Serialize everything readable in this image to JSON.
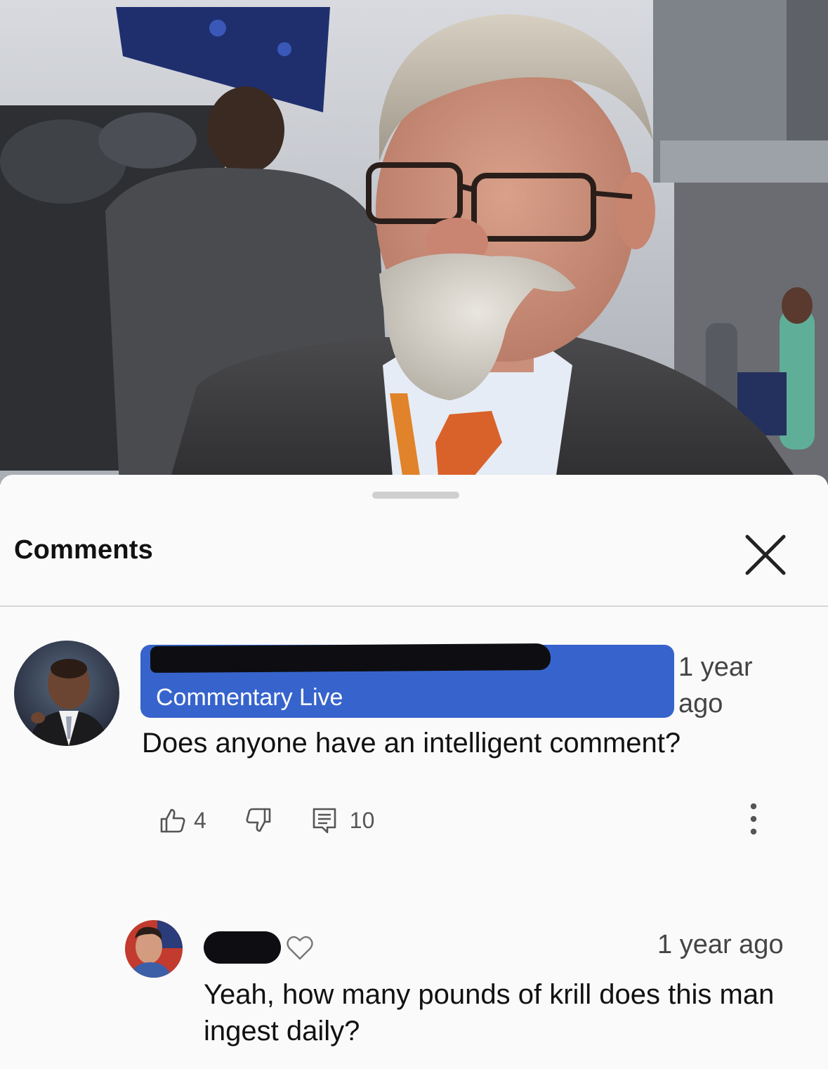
{
  "sheet": {
    "title": "Comments"
  },
  "comments": [
    {
      "author_channel": "Commentary Live",
      "time": "1 year ago",
      "text": "Does anyone have an intelligent comment?",
      "likes": "4",
      "replies": "10"
    },
    {
      "time": "1 year ago",
      "text": "Yeah, how many pounds of krill does this man ingest daily?"
    }
  ],
  "colors": {
    "chip_blue": "#3764cc",
    "sheet_bg": "#fafafa",
    "text_dark": "#111111",
    "text_muted": "#444444"
  },
  "icons": [
    "close-icon",
    "thumbs-up-icon",
    "thumbs-down-icon",
    "reply-comment-icon",
    "more-vertical-icon",
    "heart-icon"
  ]
}
